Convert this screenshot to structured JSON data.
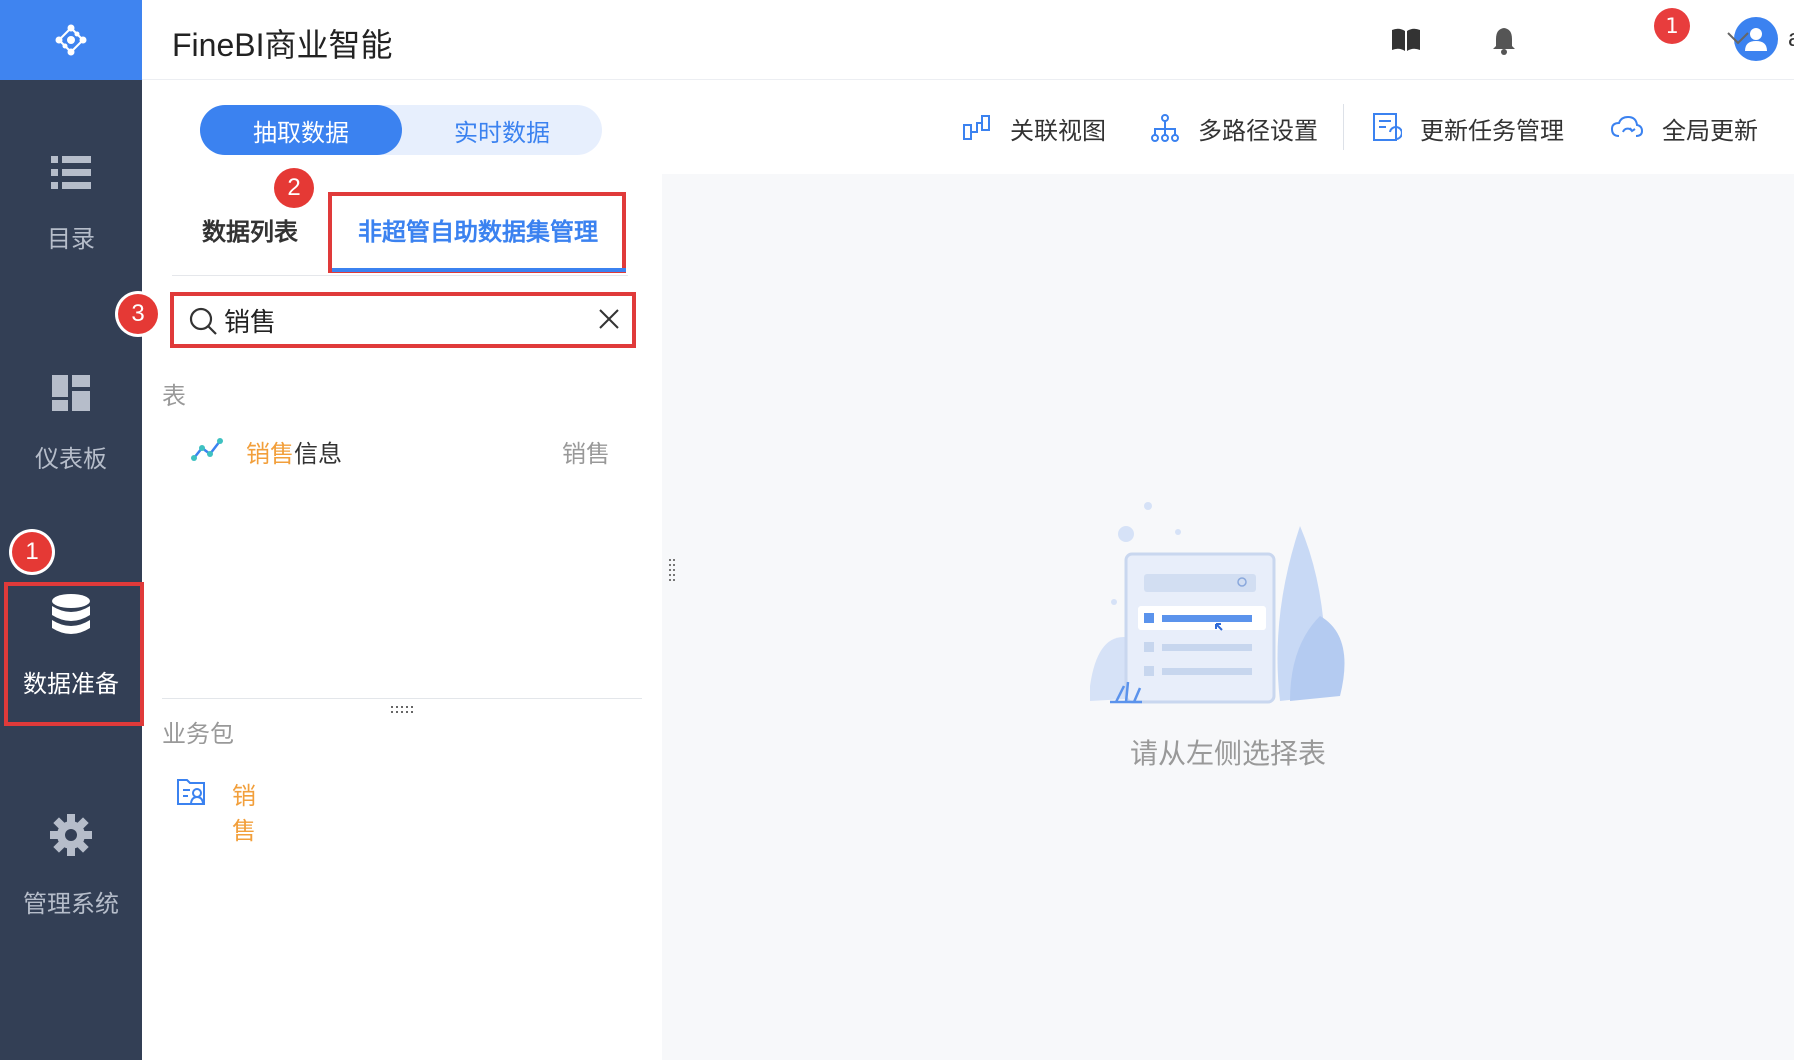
{
  "app": {
    "title": "FineBI商业智能"
  },
  "header": {
    "notification_count": "1",
    "username": "admin"
  },
  "sidebar": {
    "items": [
      {
        "label": "目录",
        "icon": "list-icon"
      },
      {
        "label": "仪表板",
        "icon": "dashboard-icon"
      },
      {
        "label": "数据准备",
        "icon": "database-icon",
        "active": true
      },
      {
        "label": "管理系统",
        "icon": "gear-icon"
      }
    ]
  },
  "mode_toggle": {
    "active": "抽取数据",
    "inactive": "实时数据"
  },
  "toolbar": {
    "relation_view": "关联视图",
    "multipath": "多路径设置",
    "update_tasks": "更新任务管理",
    "global_update": "全局更新"
  },
  "subtabs": {
    "data_list": "数据列表",
    "self_service_manage": "非超管自助数据集管理"
  },
  "search": {
    "value": "销售",
    "placeholder": ""
  },
  "tables_section": {
    "label": "表",
    "items": [
      {
        "highlight": "销售",
        "rest": "信息",
        "tag": "销售"
      }
    ]
  },
  "packages_section": {
    "label": "业务包",
    "items": [
      {
        "name": "销售"
      }
    ]
  },
  "empty_state": {
    "text": "请从左侧选择表"
  },
  "markers": {
    "m1": "1",
    "m2": "2",
    "m3": "3"
  },
  "colors": {
    "primary": "#3b82f0",
    "sidebar": "#333f55",
    "highlight": "#f29f3b",
    "marker": "#e53935"
  }
}
